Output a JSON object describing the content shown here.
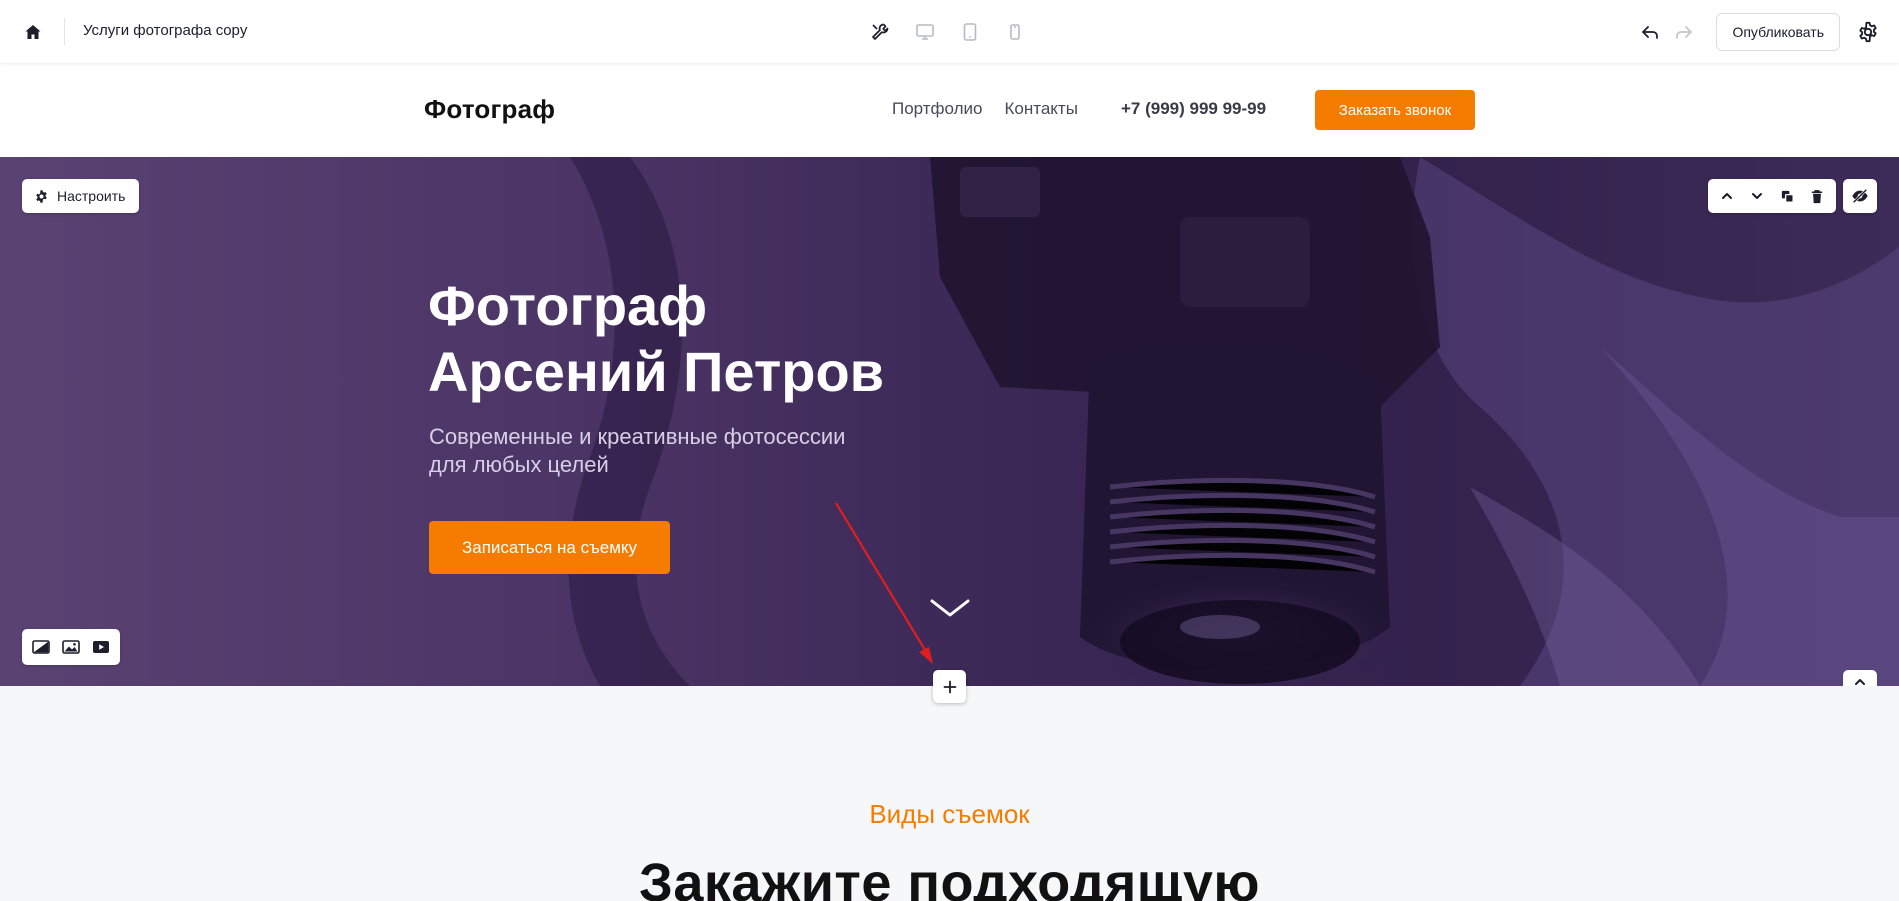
{
  "editor": {
    "site_name": "Услуги фотографа copy",
    "publish_label": "Опубликовать",
    "devices": [
      "tools-icon",
      "desktop-icon",
      "tablet-icon",
      "mobile-icon"
    ]
  },
  "header": {
    "logo": "Фотограф",
    "nav": [
      "Портфолио",
      "Контакты"
    ],
    "phone": "+7 (999) 999 99-99",
    "cta": "Заказать звонок"
  },
  "hero": {
    "configure_label": "Настроить",
    "title_line1": "Фотограф",
    "title_line2": "Арсений Петров",
    "subtitle_line1": "Современные и креативные фотосессии",
    "subtitle_line2": "для любых целей",
    "cta": "Записаться на съемку"
  },
  "section2": {
    "kicker": "Виды съемок",
    "title": "Закажите подходящую"
  },
  "colors": {
    "accent": "#f57c00",
    "hero_bg": "#3a2755",
    "annotation_arrow": "#e01e1e"
  }
}
